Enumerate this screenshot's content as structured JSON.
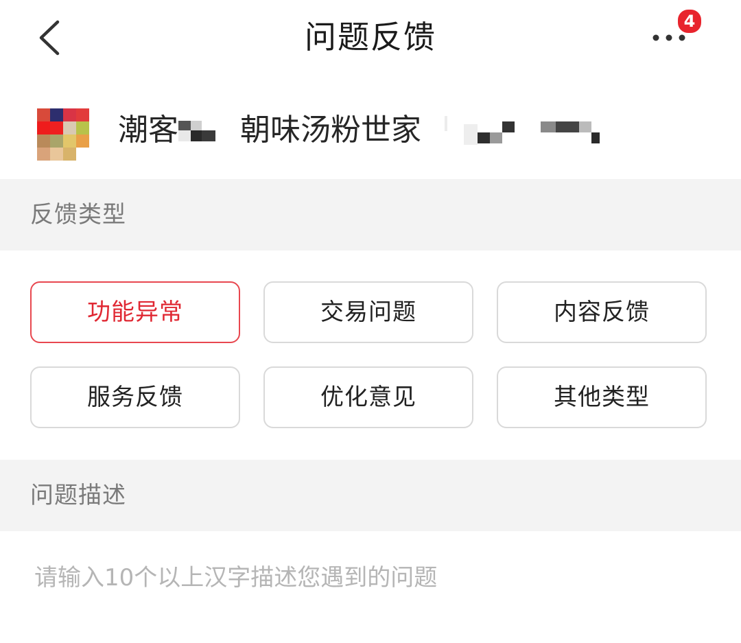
{
  "header": {
    "title": "问题反馈",
    "back_icon": "chevron-left-icon",
    "more_icon": "more-dots-icon",
    "notification_count": "4"
  },
  "shop": {
    "name_part1": "潮客",
    "name_part2": "朝味汤粉世家",
    "avatar_icon": "shop-avatar-image"
  },
  "feedback_type": {
    "label": "反馈类型",
    "selected_index": 0,
    "options": [
      {
        "label": "功能异常"
      },
      {
        "label": "交易问题"
      },
      {
        "label": "内容反馈"
      },
      {
        "label": "服务反馈"
      },
      {
        "label": "优化意见"
      },
      {
        "label": "其他类型"
      }
    ]
  },
  "description": {
    "label": "问题描述",
    "placeholder": "请输入10个以上汉字描述您遇到的问题"
  },
  "colors": {
    "accent": "#e02833",
    "badge": "#e8242d",
    "section_bg": "#f3f3f3"
  }
}
